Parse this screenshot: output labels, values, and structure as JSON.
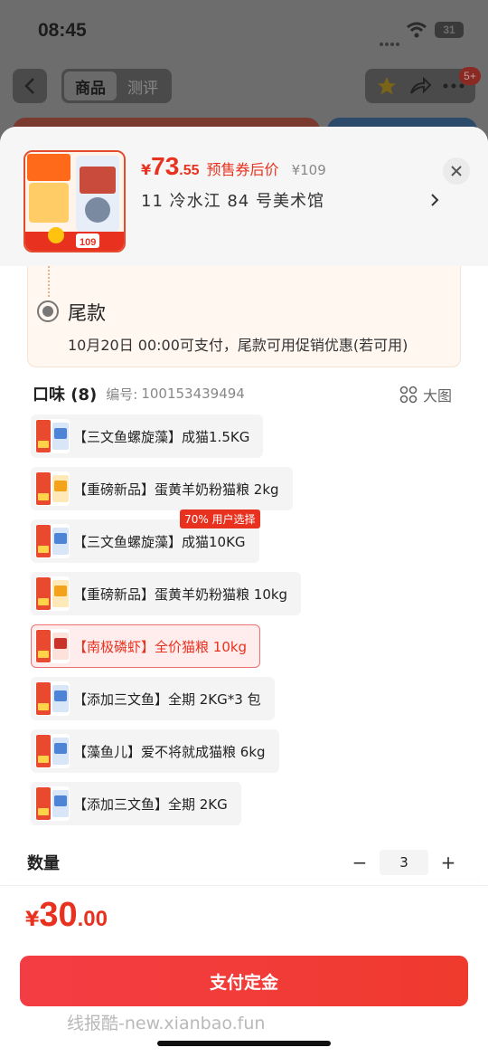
{
  "status": {
    "time": "08:45",
    "battery": "31"
  },
  "nav": {
    "tabs": [
      "商品",
      "测评"
    ],
    "active_tab": 0,
    "cart_badge": "5+"
  },
  "product": {
    "currency": "¥",
    "price_int": "73",
    "price_dec": ".55",
    "presale_label": "预售券后价",
    "original_price": "¥109",
    "address": "11 冷水江 84 号美术馆",
    "thumb_price": "109"
  },
  "final_payment": {
    "title": "尾款",
    "desc": "10月20日 00:00可支付，尾款可用促销优惠(若可用)"
  },
  "flavor": {
    "title": "口味 (8)",
    "no_label": "编号:",
    "no": "100153439494",
    "bigview": "大图",
    "options": [
      {
        "label": "【三文鱼螺旋藻】成猫1.5KG",
        "tone": "blue"
      },
      {
        "label": "【重磅新品】蛋黄羊奶粉猫粮 2kg",
        "tone": "orange"
      },
      {
        "label": "【三文鱼螺旋藻】成猫10KG",
        "tone": "blue",
        "tag": "70% 用户选择"
      },
      {
        "label": "【重磅新品】蛋黄羊奶粉猫粮 10kg",
        "tone": "orange"
      },
      {
        "label": "【南极磷虾】全价猫粮 10kg",
        "tone": "red",
        "selected": true
      },
      {
        "label": "【添加三文鱼】全期 2KG*3 包",
        "tone": "blue"
      },
      {
        "label": "【藻鱼儿】爱不将就成猫粮 6kg",
        "tone": "blue"
      },
      {
        "label": "【添加三文鱼】全期 2KG",
        "tone": "blue"
      }
    ]
  },
  "quantity": {
    "label": "数量",
    "value": "3",
    "minus": "−",
    "plus": "+"
  },
  "total": {
    "currency": "¥",
    "int": "30",
    "dec": ".00"
  },
  "pay_button": "支付定金",
  "watermark": "线报酷-new.xianbao.fun",
  "colors": {
    "accent": "#e8321f",
    "selected_bg": "#ffecec"
  }
}
